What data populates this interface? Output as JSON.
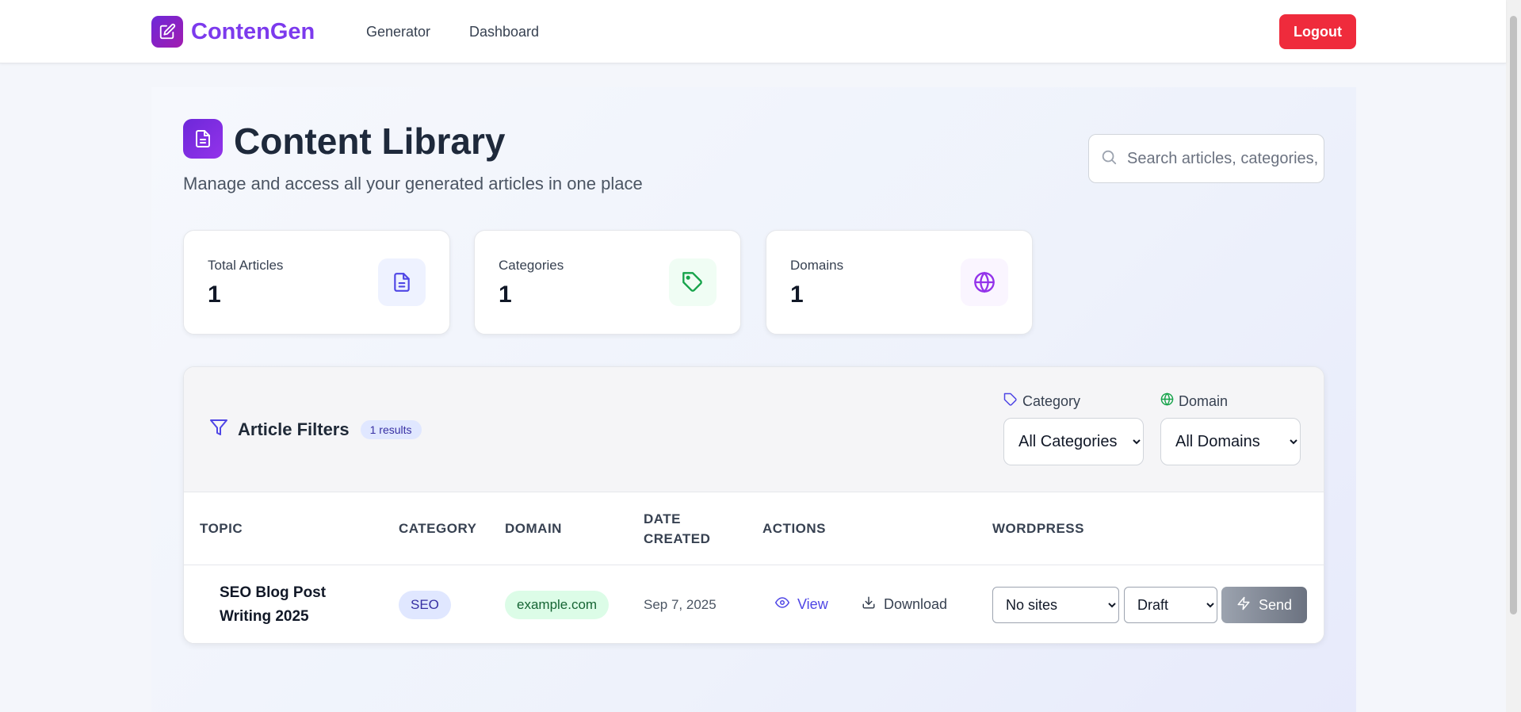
{
  "brand": {
    "name": "ContenGen",
    "icon": "edit-icon"
  },
  "nav": {
    "generator": "Generator",
    "dashboard": "Dashboard",
    "logout": "Logout"
  },
  "header": {
    "title": "Content Library",
    "subtitle": "Manage and access all your generated articles in one place",
    "search_placeholder": "Search articles, categories, domains..."
  },
  "stats": [
    {
      "label": "Total Articles",
      "value": "1",
      "icon": "document-icon",
      "color": "#4f46e5"
    },
    {
      "label": "Categories",
      "value": "1",
      "icon": "tag-icon",
      "color": "#16a34a"
    },
    {
      "label": "Domains",
      "value": "1",
      "icon": "globe-icon",
      "color": "#9333ea"
    }
  ],
  "filters": {
    "title": "Article Filters",
    "results": "1 results",
    "category_label": "Category",
    "category_value": "All Categories",
    "domain_label": "Domain",
    "domain_value": "All Domains"
  },
  "table": {
    "headers": {
      "topic": "TOPIC",
      "category": "CATEGORY",
      "domain": "DOMAIN",
      "date_line1": "DATE",
      "date_line2": "CREATED",
      "actions": "ACTIONS",
      "wordpress": "WORDPRESS"
    },
    "rows": [
      {
        "topic": "SEO Blog Post Writing 2025",
        "category": "SEO",
        "domain": "example.com",
        "date": "Sep 7, 2025",
        "view": "View",
        "download": "Download",
        "site": "No sites",
        "status": "Draft",
        "send": "Send"
      }
    ]
  },
  "colors": {
    "accent": "#7c3aed",
    "logout": "#ef2b3c",
    "link": "#4f46e5"
  }
}
